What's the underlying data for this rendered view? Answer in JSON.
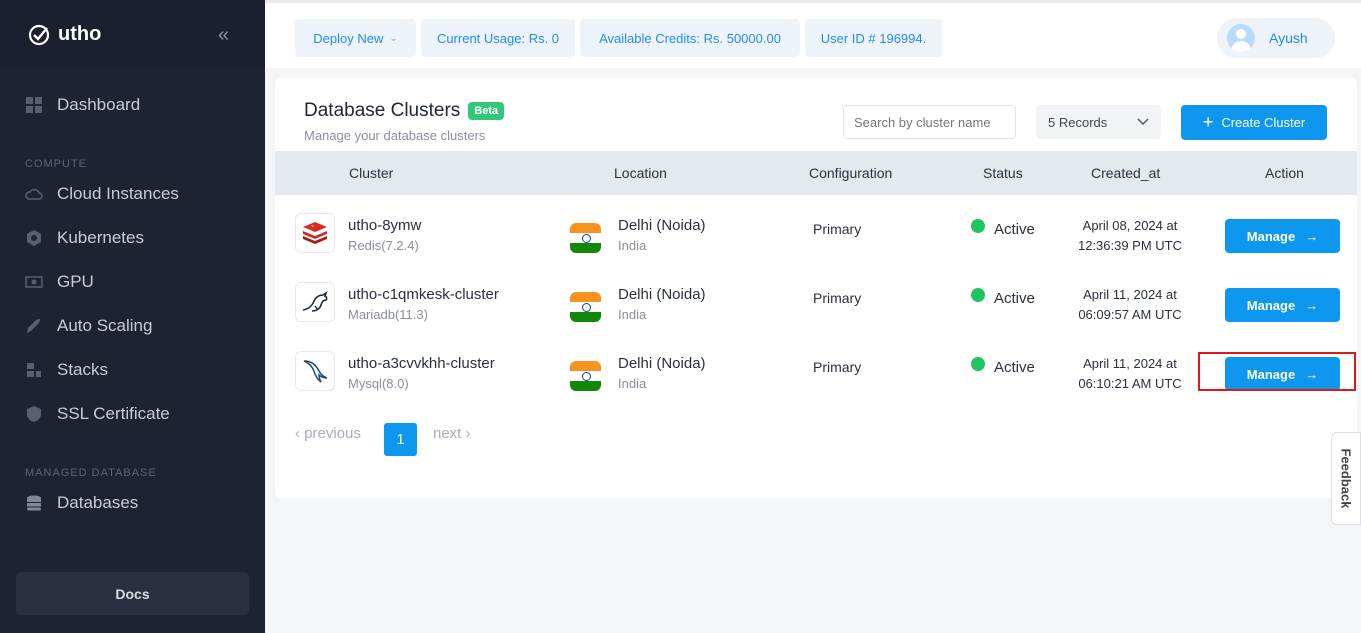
{
  "app": {
    "brand": "utho",
    "collapse_icon": "«"
  },
  "sidebar": {
    "items": [
      {
        "label": "Dashboard"
      },
      {
        "label": "Cloud Instances"
      },
      {
        "label": "Kubernetes"
      },
      {
        "label": "GPU"
      },
      {
        "label": "Auto Scaling"
      },
      {
        "label": "Stacks"
      },
      {
        "label": "SSL Certificate"
      },
      {
        "label": "Databases"
      }
    ],
    "sections": {
      "compute": "COMPUTE",
      "managed_db": "MANAGED DATABASE"
    },
    "docs_label": "Docs"
  },
  "topbar": {
    "deploy_new": "Deploy New",
    "current_usage": "Current Usage: Rs. 0",
    "available_credits": "Available Credits: Rs. 50000.00",
    "user_id": "User ID # 196994.",
    "username": "Ayush"
  },
  "page": {
    "title": "Database Clusters",
    "badge": "Beta",
    "subtitle": "Manage your database clusters",
    "search_placeholder": "Search by cluster name",
    "records": "5 Records",
    "create_label": "Create Cluster"
  },
  "table": {
    "headers": [
      "Cluster",
      "Location",
      "Configuration",
      "Status",
      "Created_at",
      "Action"
    ],
    "rows": [
      {
        "name": "utho-8ymw",
        "engine": "Redis(7.2.4)",
        "city": "Delhi (Noida)",
        "country": "India",
        "config": "Primary",
        "status": "Active",
        "created_date": "April 08, 2024 at",
        "created_time": "12:36:39 PM UTC",
        "action": "Manage"
      },
      {
        "name": "utho-c1qmkesk-cluster",
        "engine": "Mariadb(11.3)",
        "city": "Delhi (Noida)",
        "country": "India",
        "config": "Primary",
        "status": "Active",
        "created_date": "April 11, 2024 at",
        "created_time": "06:09:57 AM UTC",
        "action": "Manage"
      },
      {
        "name": "utho-a3cvvkhh-cluster",
        "engine": "Mysql(8.0)",
        "city": "Delhi (Noida)",
        "country": "India",
        "config": "Primary",
        "status": "Active",
        "created_date": "April 11, 2024 at",
        "created_time": "06:10:21 AM UTC",
        "action": "Manage"
      }
    ]
  },
  "pagination": {
    "previous": "‹ previous",
    "current": "1",
    "next": "next ›"
  },
  "feedback_label": "Feedback",
  "colors": {
    "accent": "#0d97ee",
    "sidebar": "#1f2233",
    "status_active": "#21c55d",
    "highlight": "#e01818"
  }
}
